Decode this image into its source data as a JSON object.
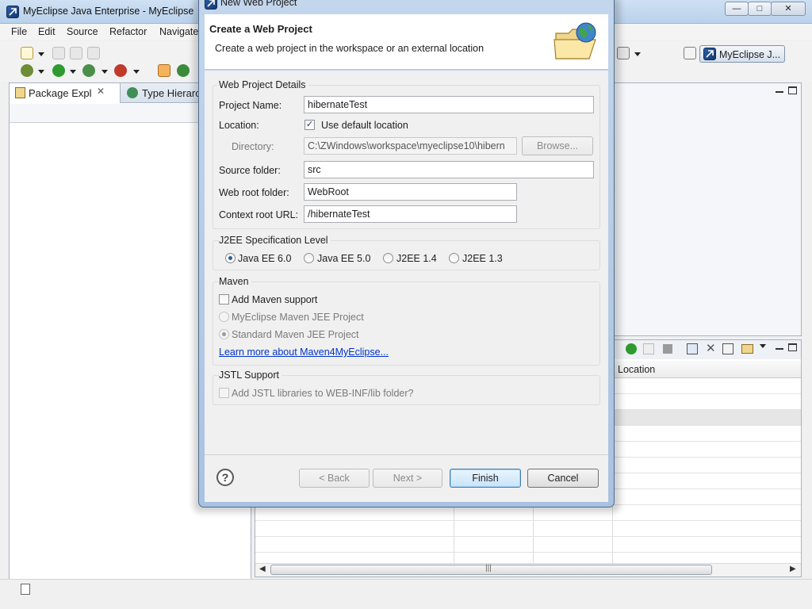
{
  "ide": {
    "title": "MyEclipse Java Enterprise - MyEclipse",
    "window_buttons": [
      "—",
      "□",
      "✕"
    ],
    "menu": [
      "File",
      "Edit",
      "Source",
      "Refactor",
      "Navigate"
    ],
    "perspective_label": "MyEclipse J...",
    "tabs": {
      "package_explorer": "Package Expl",
      "type_hierarchy": "Type Hierarc"
    },
    "table": {
      "location_header": "Location"
    },
    "scroll_grip": "|||"
  },
  "dialog": {
    "window_title": "New Web Project",
    "header_title": "Create a Web Project",
    "header_description": "Create a web project in the workspace or an external location",
    "details": {
      "legend": "Web Project Details",
      "project_name_label": "Project Name:",
      "project_name_value": "hibernateTest",
      "location_label": "Location:",
      "use_default_location_label": "Use default location",
      "use_default_location_checked": true,
      "directory_label": "Directory:",
      "directory_value": "C:\\ZWindows\\workspace\\myeclipse10\\hibern",
      "browse_label": "Browse...",
      "source_folder_label": "Source folder:",
      "source_folder_value": "src",
      "web_root_label": "Web root folder:",
      "web_root_value": "WebRoot",
      "context_root_label": "Context root URL:",
      "context_root_value": "/hibernateTest"
    },
    "j2ee": {
      "legend": "J2EE Specification Level",
      "options": [
        "Java EE 6.0",
        "Java EE 5.0",
        "J2EE 1.4",
        "J2EE 1.3"
      ],
      "selected": "Java EE 6.0"
    },
    "maven": {
      "legend": "Maven",
      "add_support_label": "Add Maven support",
      "myeclipse_jee_label": "MyEclipse Maven JEE Project",
      "standard_jee_label": "Standard Maven JEE Project",
      "learn_more_link": "Learn more about Maven4MyEclipse..."
    },
    "jstl": {
      "legend": "JSTL Support",
      "add_libraries_label": "Add JSTL libraries to WEB-INF/lib folder?"
    },
    "buttons": {
      "help": "?",
      "back": "< Back",
      "next": "Next >",
      "finish": "Finish",
      "cancel": "Cancel"
    }
  },
  "colors": {
    "accent_blue": "#2c5fa8",
    "link": "#0033cc",
    "run_green": "#2f9a2f"
  }
}
